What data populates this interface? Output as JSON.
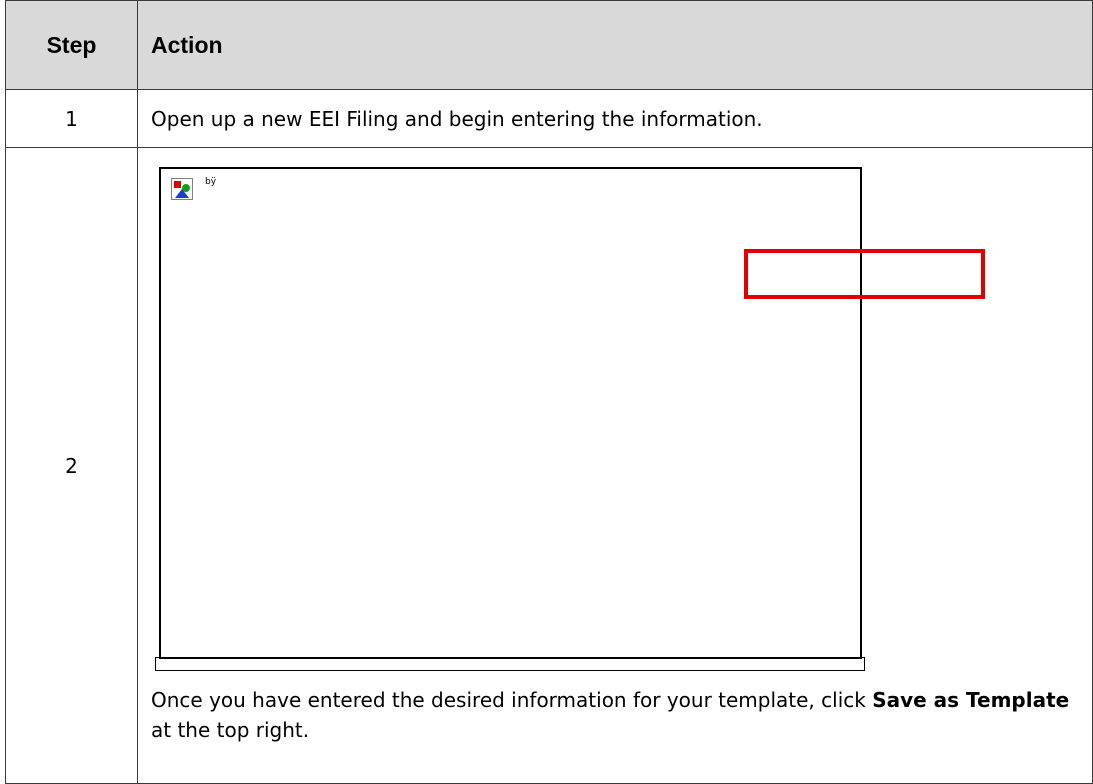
{
  "table": {
    "headers": {
      "step": "Step",
      "action": "Action"
    },
    "rows": [
      {
        "step": "1",
        "action": "Open up a new EEI Filing and begin entering the information."
      },
      {
        "step": "2",
        "screenshot": {
          "placeholder_caption": "bÿ",
          "icon": "broken-image-icon",
          "highlight_color": "#e00000"
        },
        "instruction_prefix": "Once you have entered the desired information for your template, click",
        "instruction_bold": "Save as Template",
        "instruction_suffix": "at the top right."
      }
    ]
  },
  "colors": {
    "header_background": "#d9d9d9",
    "border": "#3a3a3a",
    "highlight": "#e00000"
  }
}
